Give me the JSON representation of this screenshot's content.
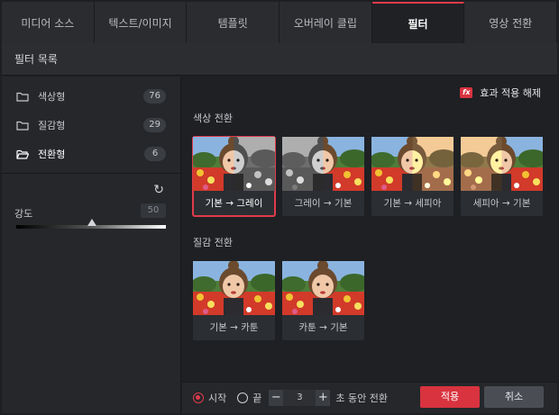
{
  "tabs": [
    {
      "label": "미디어 소스",
      "active": false
    },
    {
      "label": "텍스트/이미지",
      "active": false
    },
    {
      "label": "템플릿",
      "active": false
    },
    {
      "label": "오버레이 클립",
      "active": false
    },
    {
      "label": "필터",
      "active": true
    },
    {
      "label": "영상 전환",
      "active": false
    }
  ],
  "header": {
    "title": "필터 목록"
  },
  "sidebar": {
    "categories": [
      {
        "label": "색상형",
        "count": "76",
        "icon": "folder-icon"
      },
      {
        "label": "질감형",
        "count": "29",
        "icon": "folder-icon"
      },
      {
        "label": "전환형",
        "count": "6",
        "icon": "folder-open-icon",
        "active": true
      }
    ],
    "strength": {
      "label": "강도",
      "value": "50",
      "level": 0.5
    }
  },
  "main": {
    "clear_effect": "효과 적용 해제",
    "fx_icon_text": "fx",
    "sections": [
      {
        "title": "색상 전환",
        "items": [
          {
            "caption": "기본 → 그레이",
            "selected": true,
            "tone": "half-gray"
          },
          {
            "caption": "그레이 → 기본",
            "selected": false,
            "tone": "gray-half"
          },
          {
            "caption": "기본 → 세피아",
            "selected": false,
            "tone": "half-sepia"
          },
          {
            "caption": "세피아 → 기본",
            "selected": false,
            "tone": "sepia-half"
          }
        ]
      },
      {
        "title": "질감 전환",
        "items": [
          {
            "caption": "기본 → 카툰",
            "selected": false,
            "tone": "normal"
          },
          {
            "caption": "카툰 → 기본",
            "selected": false,
            "tone": "normal"
          }
        ]
      }
    ]
  },
  "footer": {
    "start_label": "시작",
    "end_label": "끝",
    "duration_value": "3",
    "duration_suffix": "초 동안 전환",
    "apply_label": "적용",
    "cancel_label": "취소"
  },
  "colors": {
    "accent": "#d8333f",
    "background": "#1d1f23"
  }
}
